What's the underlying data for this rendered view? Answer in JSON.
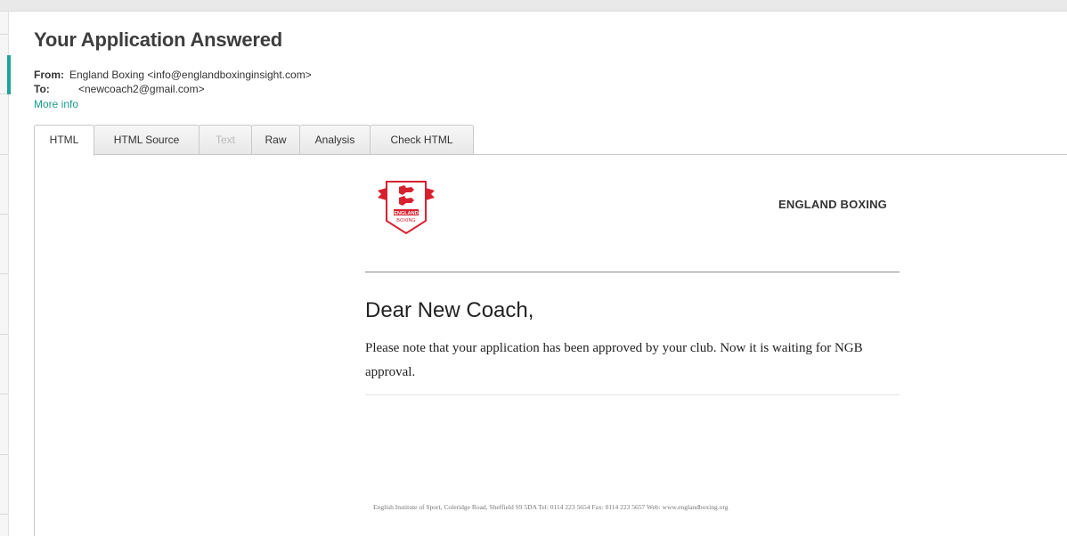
{
  "message": {
    "subject": "Your Application Answered",
    "from_label": "From:",
    "from_value": "England Boxing <info@englandboxinginsight.com>",
    "to_label": "To:",
    "to_value": "<newcoach2@gmail.com>",
    "more_info": "More info"
  },
  "tabs": [
    {
      "label": "HTML",
      "state": "active"
    },
    {
      "label": "HTML Source",
      "state": "normal"
    },
    {
      "label": "Text",
      "state": "disabled"
    },
    {
      "label": "Raw",
      "state": "normal"
    },
    {
      "label": "Analysis",
      "state": "normal"
    },
    {
      "label": "Check HTML",
      "state": "normal"
    }
  ],
  "email": {
    "logo_text_top": "ENGLAND",
    "logo_text_bottom": "BOXING",
    "brand": "ENGLAND BOXING",
    "greeting": "Dear New Coach,",
    "body": "Please note that your application has been approved by your club. Now it is waiting for NGB approval.",
    "footer": "English Institute of Sport, Coleridge Road, Sheffield S9 5DA Tel: 0114 223 5654   Fax: 0114 223 5657   Web: www.englandboxing.org"
  },
  "colors": {
    "accent": "#1a9a8d",
    "logo_red": "#d8212f"
  },
  "icons": {
    "logo": "england-boxing-shield-logo"
  }
}
